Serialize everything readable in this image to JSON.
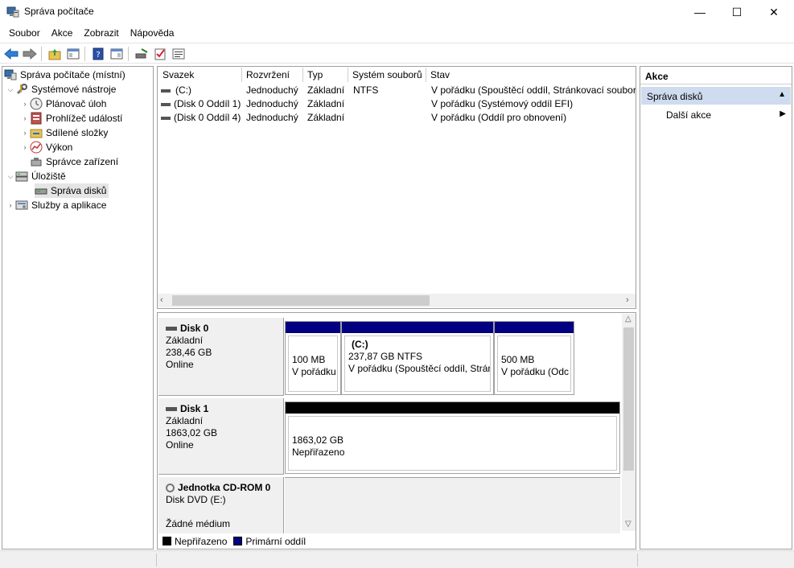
{
  "window": {
    "title": "Správa počítače",
    "minimize": "—",
    "maximize": "☐",
    "close": "✕"
  },
  "menu": [
    "Soubor",
    "Akce",
    "Zobrazit",
    "Nápověda"
  ],
  "tree": {
    "root": "Správa počítače (místní)",
    "system_tools": "Systémové nástroje",
    "task_scheduler": "Plánovač úloh",
    "event_viewer": "Prohlížeč událostí",
    "shared_folders": "Sdílené složky",
    "performance": "Výkon",
    "device_manager": "Správce zařízení",
    "storage": "Úložiště",
    "disk_management": "Správa disků",
    "services": "Služby a aplikace"
  },
  "volume_table": {
    "headers": [
      "Svazek",
      "Rozvržení",
      "Typ",
      "Systém souborů",
      "Stav"
    ],
    "rows": [
      [
        "(C:)",
        "Jednoduchý",
        "Základní",
        "NTFS",
        "V pořádku (Spouštěcí oddíl, Stránkovací soubor,"
      ],
      [
        "(Disk 0 Oddíl 1)",
        "Jednoduchý",
        "Základní",
        "",
        "V pořádku (Systémový oddíl EFI)"
      ],
      [
        "(Disk 0 Oddíl 4)",
        "Jednoduchý",
        "Základní",
        "",
        "V pořádku (Oddíl pro obnovení)"
      ]
    ]
  },
  "disks": {
    "disk0": {
      "name": "Disk 0",
      "type": "Základní",
      "size": "238,46 GB",
      "status": "Online",
      "p1": {
        "size": "100 MB",
        "status": "V pořádku"
      },
      "p2": {
        "label": "(C:)",
        "size": "237,87 GB NTFS",
        "status": "V pořádku (Spouštěcí oddíl, Strán"
      },
      "p3": {
        "size": "500 MB",
        "status": "V pořádku (Odc"
      }
    },
    "disk1": {
      "name": "Disk 1",
      "type": "Základní",
      "size": "1863,02 GB",
      "status": "Online",
      "p1": {
        "size": "1863,02 GB",
        "status": "Nepřiřazeno"
      }
    },
    "cdrom": {
      "name": "Jednotka CD-ROM 0",
      "type": "Disk DVD (E:)",
      "status": "Žádné médium"
    }
  },
  "legend": {
    "unallocated": "Nepřiřazeno",
    "primary": "Primární oddíl"
  },
  "actions": {
    "header": "Akce",
    "section": "Správa disků",
    "more": "Další akce"
  },
  "colors": {
    "primary_partition": "#000080",
    "unallocated": "#000000",
    "selected_section": "#cfdcef"
  }
}
